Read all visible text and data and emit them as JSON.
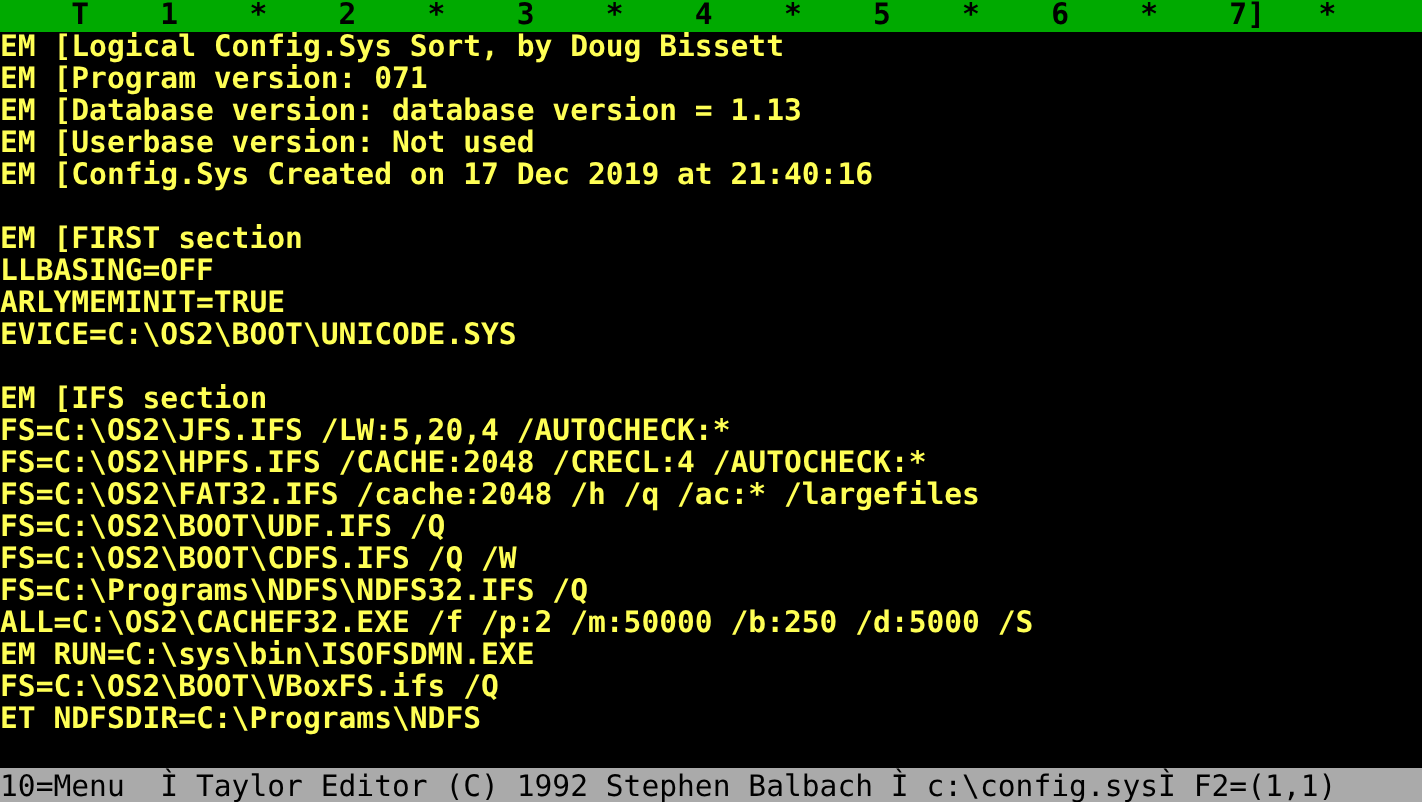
{
  "ruler": {
    "text": "    T    1    *    2    *    3    *    4    *    5    *    6    *    7]   *"
  },
  "editor": {
    "blocks": [
      {
        "lines": [
          "EM [Logical Config.Sys Sort, by Doug Bissett",
          "EM [Program version: 071",
          "EM [Database version: database version = 1.13",
          "EM [Userbase version: Not used",
          "EM [Config.Sys Created on 17 Dec 2019 at 21:40:16"
        ]
      },
      {
        "lines": [
          "EM [FIRST section",
          "LLBASING=OFF",
          "ARLYMEMINIT=TRUE",
          "EVICE=C:\\OS2\\BOOT\\UNICODE.SYS"
        ]
      },
      {
        "lines": [
          "EM [IFS section",
          "FS=C:\\OS2\\JFS.IFS /LW:5,20,4 /AUTOCHECK:*",
          "FS=C:\\OS2\\HPFS.IFS /CACHE:2048 /CRECL:4 /AUTOCHECK:*",
          "FS=C:\\OS2\\FAT32.IFS /cache:2048 /h /q /ac:* /largefiles",
          "FS=C:\\OS2\\BOOT\\UDF.IFS /Q",
          "FS=C:\\OS2\\BOOT\\CDFS.IFS /Q /W",
          "FS=C:\\Programs\\NDFS\\NDFS32.IFS /Q",
          "ALL=C:\\OS2\\CACHEF32.EXE /f /p:2 /m:50000 /b:250 /d:5000 /S",
          "EM RUN=C:\\sys\\bin\\ISOFSDMN.EXE",
          "FS=C:\\OS2\\BOOT\\VBoxFS.ifs /Q",
          "ET NDFSDIR=C:\\Programs\\NDFS"
        ]
      }
    ]
  },
  "status_bar": {
    "text": "10=Menu  Ì Taylor Editor (C) 1992 Stephen Balbach Ì c:\\config.sysÌ F2=(1,1)"
  }
}
